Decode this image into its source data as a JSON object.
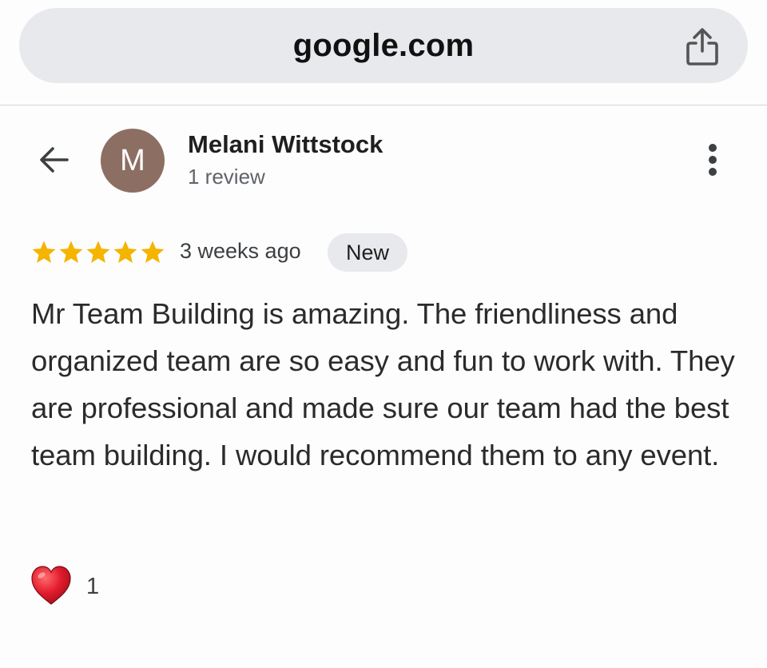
{
  "browser": {
    "url": "google.com",
    "share_icon": "share-icon"
  },
  "reviewer": {
    "name": "Melani Wittstock",
    "avatar_letter": "M",
    "avatar_color": "#8d6e63",
    "review_count": "1 review"
  },
  "review": {
    "rating": 5,
    "max_rating": 5,
    "star_color": "#f4b400",
    "timestamp": "3 weeks ago",
    "badge": "New",
    "text": "Mr Team Building is amazing. The friendliness and organized team are so easy and fun to work with. They are professional and made sure our team had the best team building. I would recommend them to any event."
  },
  "reactions": {
    "heart_icon": "red-heart-emoji",
    "heart_count": "1"
  },
  "icons": {
    "back": "back-arrow-icon",
    "more": "more-vert-icon"
  }
}
